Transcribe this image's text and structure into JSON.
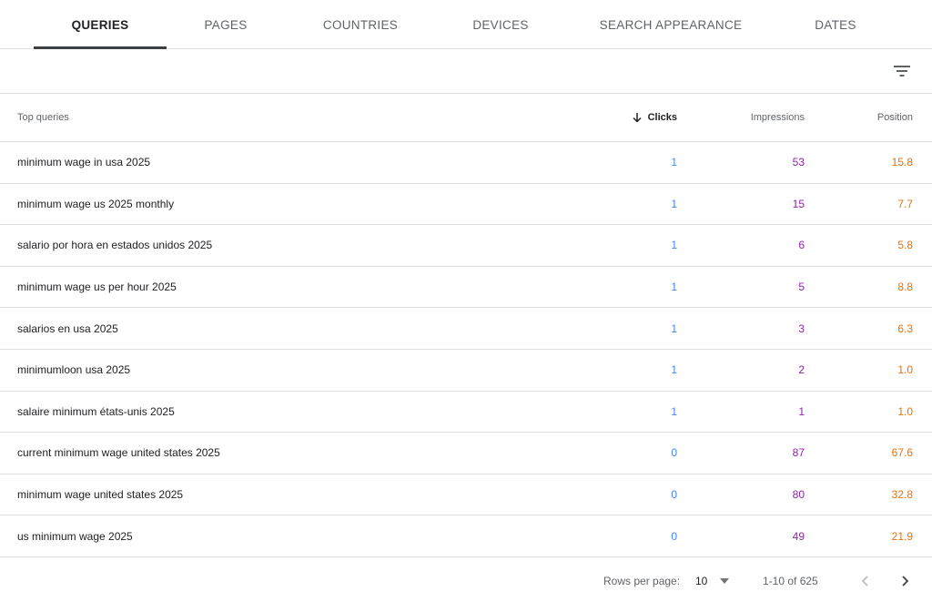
{
  "tabs": [
    {
      "label": "QUERIES",
      "active": true
    },
    {
      "label": "PAGES",
      "active": false
    },
    {
      "label": "COUNTRIES",
      "active": false
    },
    {
      "label": "DEVICES",
      "active": false
    },
    {
      "label": "SEARCH APPEARANCE",
      "active": false
    },
    {
      "label": "DATES",
      "active": false
    }
  ],
  "toolbar": {
    "filter_icon": "filter-list-icon"
  },
  "table": {
    "headers": {
      "query": "Top queries",
      "clicks": "Clicks",
      "impressions": "Impressions",
      "position": "Position"
    },
    "sort_icon": "arrow-down-icon",
    "rows": [
      {
        "query": "minimum wage in usa 2025",
        "clicks": "1",
        "impressions": "53",
        "position": "15.8"
      },
      {
        "query": "minimum wage us 2025 monthly",
        "clicks": "1",
        "impressions": "15",
        "position": "7.7"
      },
      {
        "query": "salario por hora en estados unidos 2025",
        "clicks": "1",
        "impressions": "6",
        "position": "5.8"
      },
      {
        "query": "minimum wage us per hour 2025",
        "clicks": "1",
        "impressions": "5",
        "position": "8.8"
      },
      {
        "query": "salarios en usa 2025",
        "clicks": "1",
        "impressions": "3",
        "position": "6.3"
      },
      {
        "query": "minimumloon usa 2025",
        "clicks": "1",
        "impressions": "2",
        "position": "1.0"
      },
      {
        "query": "salaire minimum états-unis 2025",
        "clicks": "1",
        "impressions": "1",
        "position": "1.0"
      },
      {
        "query": "current minimum wage united states 2025",
        "clicks": "0",
        "impressions": "87",
        "position": "67.6"
      },
      {
        "query": "minimum wage united states 2025",
        "clicks": "0",
        "impressions": "80",
        "position": "32.8"
      },
      {
        "query": "us minimum wage 2025",
        "clicks": "0",
        "impressions": "49",
        "position": "21.9"
      }
    ]
  },
  "pagination": {
    "rows_per_page_label": "Rows per page:",
    "rows_per_page_value": "10",
    "range": "1-10 of 625",
    "prev_icon": "chevron-left-icon",
    "next_icon": "chevron-right-icon"
  },
  "colors": {
    "clicks": "#4285f4",
    "impressions": "#8e24aa",
    "position": "#e8710a"
  }
}
